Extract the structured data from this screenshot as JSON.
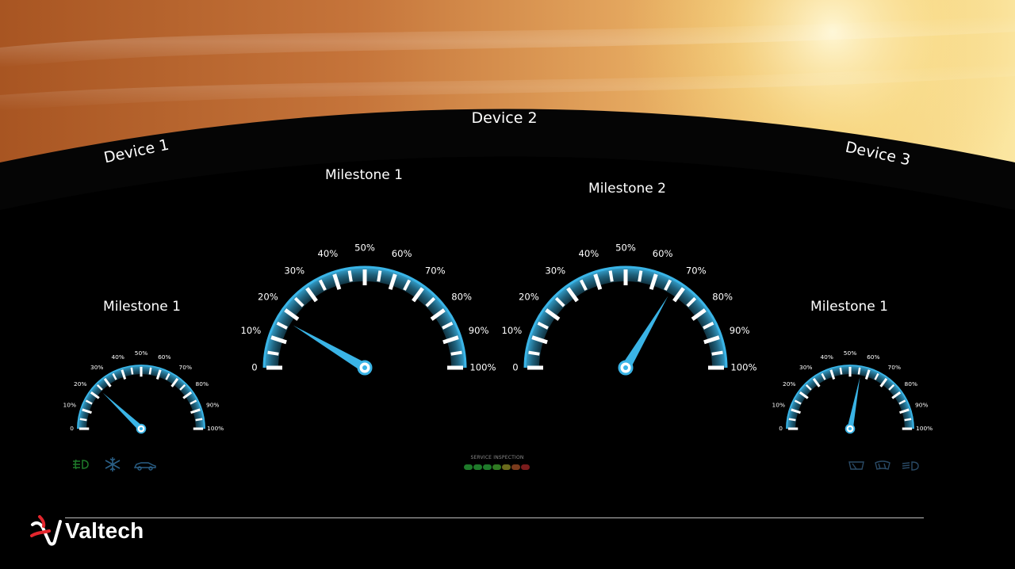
{
  "devices": {
    "device1": "Device 1",
    "device2": "Device 2",
    "device3": "Device 3"
  },
  "gauges": [
    {
      "id": "g1",
      "title": "Milestone 1",
      "value": 24,
      "ticks": [
        "0",
        "10%",
        "20%",
        "30%",
        "40%",
        "50%",
        "60%",
        "70%",
        "80%",
        "90%",
        "100%"
      ]
    },
    {
      "id": "g2",
      "title": "Milestone 1",
      "value": 17,
      "ticks": [
        "0",
        "10%",
        "20%",
        "30%",
        "40%",
        "50%",
        "60%",
        "70%",
        "80%",
        "90%",
        "100%"
      ]
    },
    {
      "id": "g3",
      "title": "Milestone 2",
      "value": 67,
      "ticks": [
        "0",
        "10%",
        "20%",
        "30%",
        "40%",
        "50%",
        "60%",
        "70%",
        "80%",
        "90%",
        "100%"
      ]
    },
    {
      "id": "g4",
      "title": "Milestone 1",
      "value": 56,
      "ticks": [
        "0",
        "10%",
        "20%",
        "30%",
        "40%",
        "50%",
        "60%",
        "70%",
        "80%",
        "90%",
        "100%"
      ]
    }
  ],
  "service": {
    "label": "SERVICE INSPECTION",
    "segments": [
      "#1e7a2a",
      "#1e7a2a",
      "#1e7a2a",
      "#2f7a22",
      "#6a6a1c",
      "#7a3a1c",
      "#7a1c1c"
    ]
  },
  "indicators": {
    "left": [
      "fog-light-icon",
      "snowflake-icon",
      "car-icon"
    ],
    "right": [
      "rear-wiper-icon",
      "front-wiper-icon",
      "headlight-icon"
    ]
  },
  "brand": {
    "name": "Valtech",
    "accent": "#e3262d",
    "gauge_color": "#3ab4e6"
  }
}
